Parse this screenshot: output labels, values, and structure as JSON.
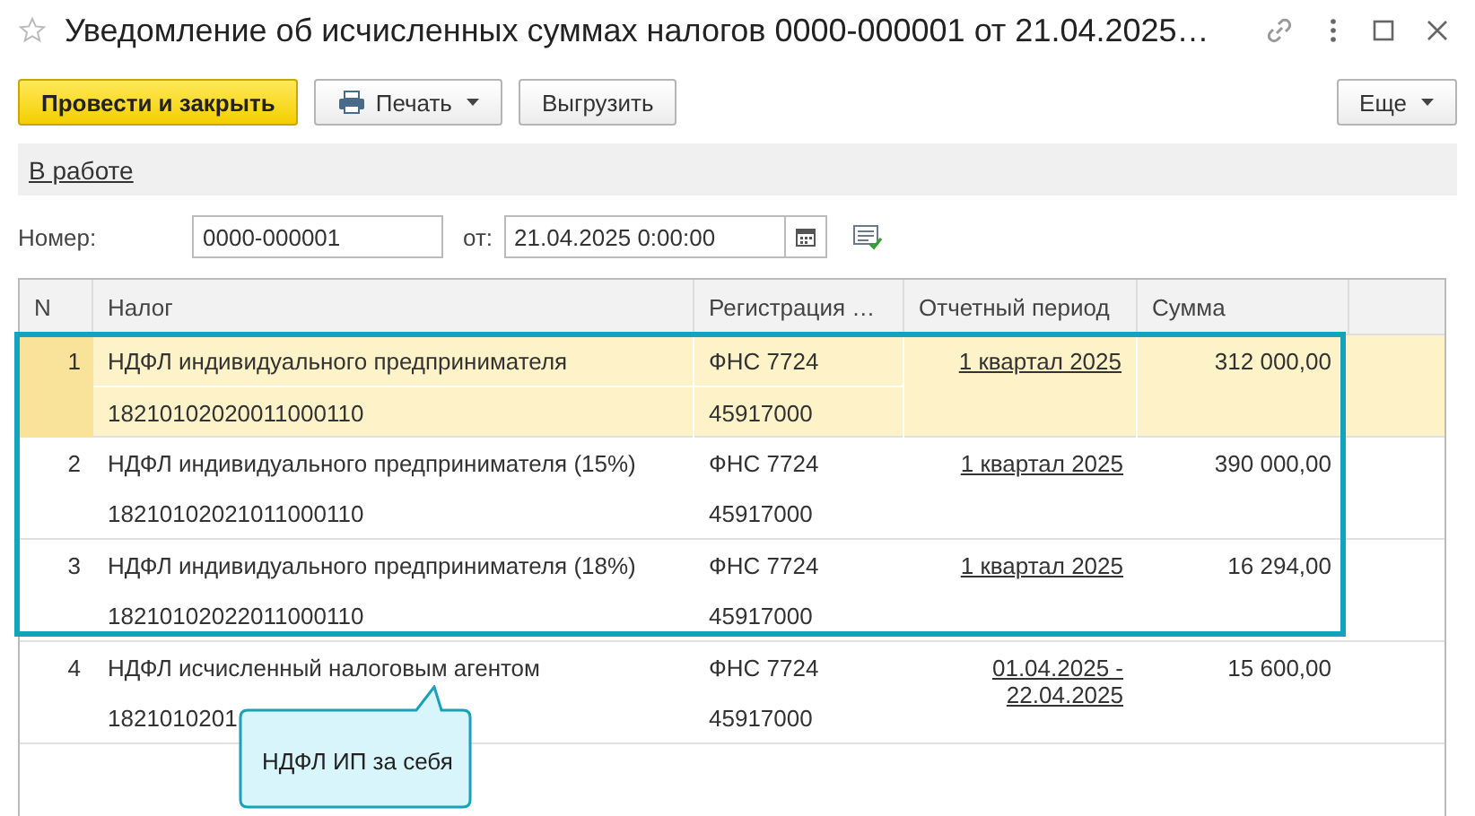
{
  "window": {
    "title": "Уведомление об исчисленных суммах налогов 0000-000001 от 21.04.2025…",
    "favorite": false
  },
  "toolbar": {
    "buttons": [
      {
        "label": "Провести и закрыть",
        "kind": "primary"
      },
      {
        "label": "Печать",
        "kind": "print"
      },
      {
        "label": "Выгрузить",
        "kind": "plain"
      }
    ],
    "more": "Еще"
  },
  "status_link": "В работе",
  "fields": {
    "number_label": "Номер:",
    "number": "0000-000001",
    "date_label": "от:",
    "date": "21.04.2025  0:00:00"
  },
  "table": {
    "columns": [
      "N",
      "Налог",
      "Регистрация …",
      "Отчетный период",
      "Сумма"
    ],
    "rows": [
      {
        "n": "1",
        "tax": "НДФЛ индивидуального предпринимателя",
        "kbk": "18210102020011000110",
        "registration": "ФНС 7724",
        "oktmo": "45917000",
        "period": "1 квартал 2025",
        "sum": "312 000,00",
        "selected": true
      },
      {
        "n": "2",
        "tax": "НДФЛ индивидуального предпринимателя (15%)",
        "kbk": "18210102021011000110",
        "registration": "ФНС 7724",
        "oktmo": "45917000",
        "period": "1 квартал 2025",
        "sum": "390 000,00",
        "selected": false
      },
      {
        "n": "3",
        "tax": "НДФЛ индивидуального предпринимателя (18%)",
        "kbk": "18210102022011000110",
        "registration": "ФНС 7724",
        "oktmo": "45917000",
        "period": "1 квартал 2025",
        "sum": "16 294,00",
        "selected": false
      },
      {
        "n": "4",
        "tax": "НДФЛ исчисленный налоговым агентом",
        "kbk": "1821010201",
        "registration": "ФНС 7724",
        "oktmo": "45917000",
        "period": "01.04.2025 - 22.04.2025",
        "sum": "15 600,00",
        "selected": false
      }
    ]
  },
  "callout": {
    "text": "НДФЛ ИП за себя"
  }
}
